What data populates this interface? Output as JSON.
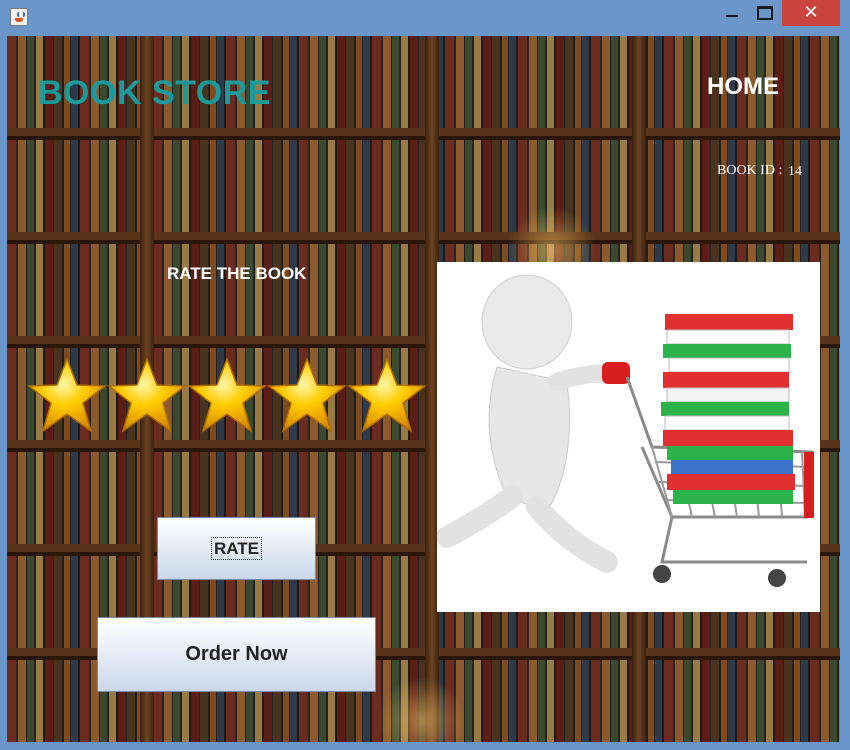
{
  "window": {
    "close_glyph": "✕"
  },
  "header": {
    "brand": "BOOK STORE",
    "home_label": "HOME"
  },
  "book": {
    "id_label": "BOOK ID :",
    "id_value": "14"
  },
  "rating": {
    "title": "RATE THE BOOK",
    "stars_filled": 5,
    "stars_total": 5,
    "rate_button_label": "RATE"
  },
  "order": {
    "button_label": "Order Now"
  },
  "colors": {
    "brand": "#1a9a9a",
    "star": "#ffcc00",
    "titlebar": "#6b96ca",
    "close_button": "#c9443c"
  },
  "icons": {
    "app": "java-cup-icon",
    "minimize": "minimize-icon",
    "maximize": "maximize-icon",
    "close": "close-icon"
  }
}
